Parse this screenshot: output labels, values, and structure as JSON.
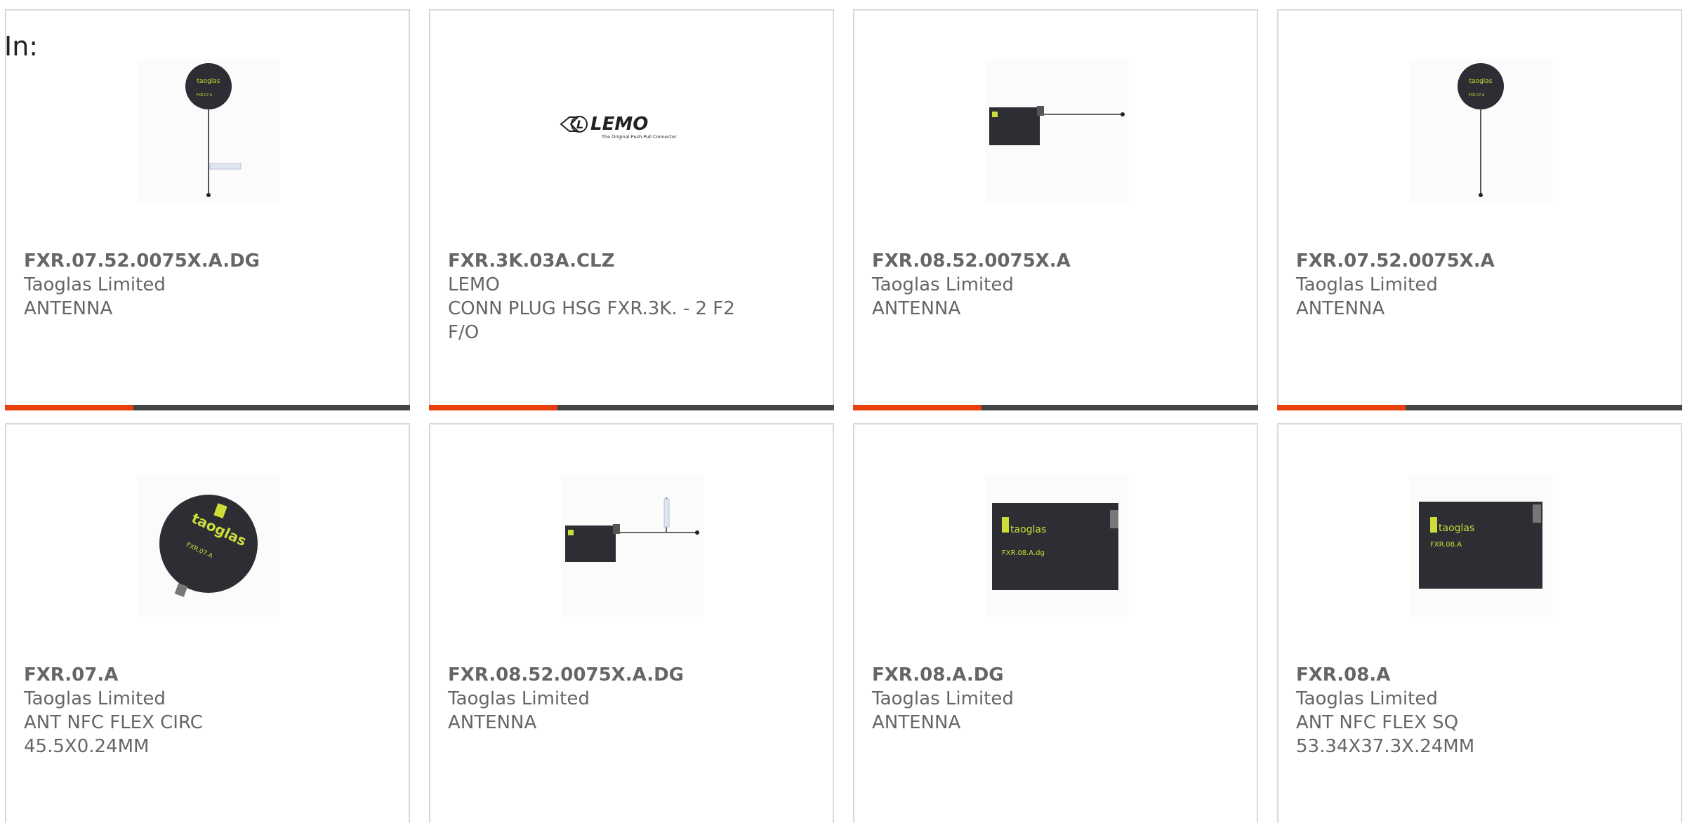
{
  "filter_label": "In:",
  "accent_color": "#e8400c",
  "bar_color": "#444444",
  "products": [
    {
      "part_number": "FXR.07.52.0075X.A.DG",
      "manufacturer": "Taoglas Limited",
      "description": "ANTENNA",
      "image_icon": "round-nfc-antenna-with-cable"
    },
    {
      "part_number": "FXR.3K.03A.CLZ",
      "manufacturer": "LEMO",
      "description": "CONN PLUG HSG FXR.3K. - 2 F2 F/O",
      "image_icon": "lemo-logo",
      "logo_text": "LEMO",
      "logo_tagline": "The Original Push-Pull Connector"
    },
    {
      "part_number": "FXR.08.52.0075X.A",
      "manufacturer": "Taoglas Limited",
      "description": "ANTENNA",
      "image_icon": "square-nfc-antenna-with-cable"
    },
    {
      "part_number": "FXR.07.52.0075X.A",
      "manufacturer": "Taoglas Limited",
      "description": "ANTENNA",
      "image_icon": "round-nfc-antenna-with-cable"
    },
    {
      "part_number": "FXR.07.A",
      "manufacturer": "Taoglas Limited",
      "description": "ANT NFC FLEX CIRC 45.5X0.24MM",
      "image_icon": "round-nfc-antenna",
      "print_brand": "taoglas",
      "print_model": "FXR.07.A"
    },
    {
      "part_number": "FXR.08.52.0075X.A.DG",
      "manufacturer": "Taoglas Limited",
      "description": "ANTENNA",
      "image_icon": "square-nfc-antenna-with-cable"
    },
    {
      "part_number": "FXR.08.A.DG",
      "manufacturer": "Taoglas Limited",
      "description": "ANTENNA",
      "image_icon": "square-nfc-antenna",
      "print_brand": "taoglas",
      "print_model": "FXR.08.A.dg"
    },
    {
      "part_number": "FXR.08.A",
      "manufacturer": "Taoglas Limited",
      "description": "ANT NFC FLEX SQ 53.34X37.3X.24MM",
      "image_icon": "square-nfc-antenna",
      "print_brand": "taoglas",
      "print_model": "FXR.08.A"
    }
  ]
}
